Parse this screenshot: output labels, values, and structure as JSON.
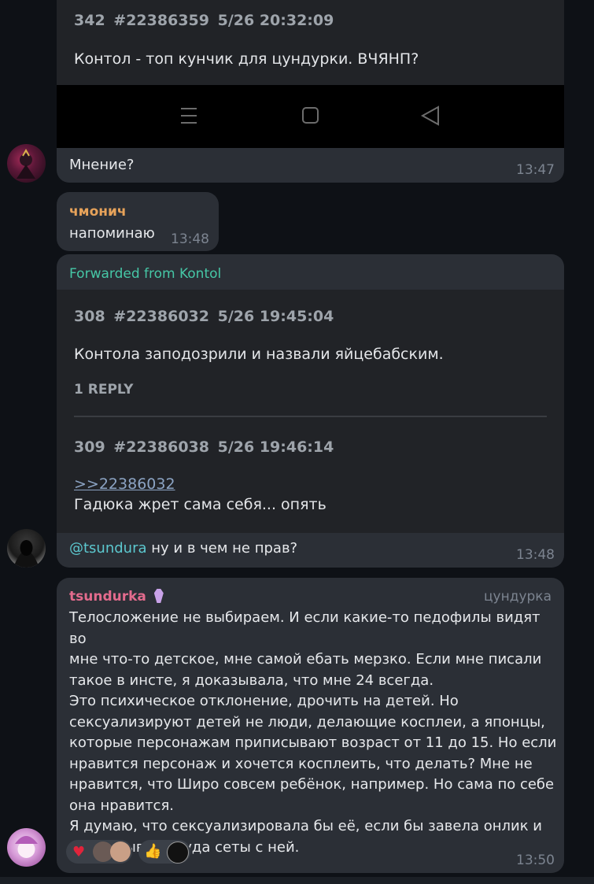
{
  "msg1": {
    "quote": {
      "num": "342",
      "id": "#22386359",
      "date": "5/26 20:32:09",
      "text": "Контол - топ кунчик для цундурки. ВЧЯНП?"
    },
    "text": "Мнение?",
    "time": "13:47"
  },
  "msg2": {
    "sender": "чмонич",
    "sender_color": "#e6a25a",
    "text": "напоминаю",
    "time": "13:48"
  },
  "msg3": {
    "forward_label": "Forwarded from Kontol",
    "forward_color": "#46c7a6",
    "post1": {
      "num": "308",
      "id": "#22386032",
      "date": "5/26 19:45:04",
      "text": "Контола заподозрили и назвали яйцебабским.",
      "replies": "1 REPLY"
    },
    "post2": {
      "num": "309",
      "id": "#22386038",
      "date": "5/26 19:46:14",
      "link": ">>22386032",
      "text": "Гадюка жрет сама себя... опять"
    },
    "mention": "@tsundura",
    "text": " ну и в чем не прав?",
    "time": "13:48"
  },
  "msg4": {
    "sender": "tsundurka",
    "sender_color": "#e36b8d",
    "badge_icon": "coffin-emoji",
    "title": "цундурка",
    "lines": [
      "Телосложение не выбираем. И если какие-то педофилы видят во",
      "мне что-то детское, мне самой ебать мерзко. Если мне писали",
      "такое в инсте, я доказывала, что мне 24 всегда.",
      "Это психическое отклонение, дрочить на детей. Но",
      "сексуализируют детей не люди, делающие косплеи, а японцы,",
      "которые персонажам приписывают возраст от 11 до 15. Но если",
      "нравится персонаж и хочется косплеить, что делать? Мне не",
      "нравится, что Широ совсем ребёнок, например. Но сама по себе",
      "она нравится.",
      "Я думаю, что сексуализировала бы её, если бы завела онлик и",
      "выкладывала туда сеты с ней."
    ],
    "reactions": [
      {
        "icon": "red-heart-emoji"
      },
      {
        "icon": "thumbs-up-emoji"
      }
    ],
    "time": "13:50"
  }
}
